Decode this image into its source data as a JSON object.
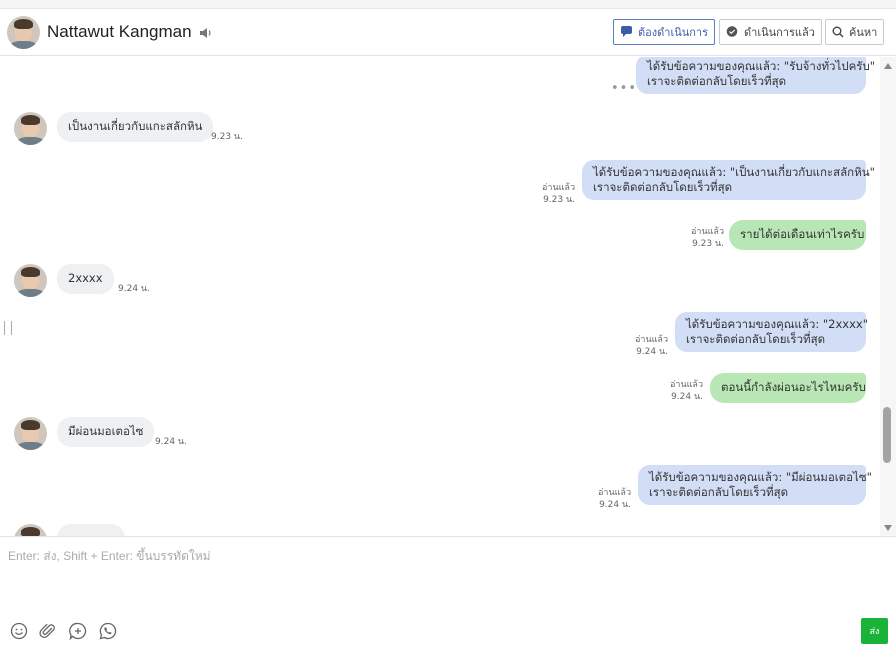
{
  "header": {
    "contact_name": "Nattawut Kangman",
    "buttons": {
      "pending": "ต้องดำเนินการ",
      "done": "ดำเนินการแล้ว",
      "search": "ค้นหา"
    }
  },
  "messages": [
    {
      "type": "bot",
      "line1": "ได้รับข้อความของคุณแล้ว: \"รับจ้างทั่วไปครับ\"",
      "line2": "เราจะติดต่อกลับโดยเร็วที่สุด"
    },
    {
      "type": "in",
      "text": "เป็นงานเกี่ยวกับแกะสลักหิน",
      "time": "9.23 น."
    },
    {
      "type": "bot",
      "line1": "ได้รับข้อความของคุณแล้ว: \"เป็นงานเกี่ยวกับแกะสลักหิน\"",
      "line2": "เราจะติดต่อกลับโดยเร็วที่สุด",
      "read": "อ่านแล้ว",
      "time": "9.23 น."
    },
    {
      "type": "me",
      "text": "รายได้ต่อเดือนเท่าไรครับ",
      "read": "อ่านแล้ว",
      "time": "9.23 น."
    },
    {
      "type": "in",
      "text": "2xxxx",
      "time": "9.24 น."
    },
    {
      "type": "bot",
      "line1": "ได้รับข้อความของคุณแล้ว: \"2xxxx\"",
      "line2": "เราจะติดต่อกลับโดยเร็วที่สุด",
      "read": "อ่านแล้ว",
      "time": "9.24 น."
    },
    {
      "type": "me",
      "text": "ตอนนี้กำลังผ่อนอะไรไหมครับ",
      "read": "อ่านแล้ว",
      "time": "9.24 น."
    },
    {
      "type": "in",
      "text": "มีผ่อนมอเตอไซ",
      "time": "9.24 น."
    },
    {
      "type": "bot",
      "line1": "ได้รับข้อความของคุณแล้ว: \"มีผ่อนมอเตอไซ\"",
      "line2": "เราจะติดต่อกลับโดยเร็วที่สุด",
      "read": "อ่านแล้ว",
      "time": "9.24 น."
    }
  ],
  "composer": {
    "placeholder": "Enter: ส่ง, Shift + Enter: ขึ้นบรรทัดใหม่",
    "send_label": "ส่ง"
  },
  "colors": {
    "bot_bubble": "#d2def5",
    "my_bubble": "#b8e6b5",
    "incoming_bubble": "#eef0f2",
    "send_button": "#19b33a"
  }
}
